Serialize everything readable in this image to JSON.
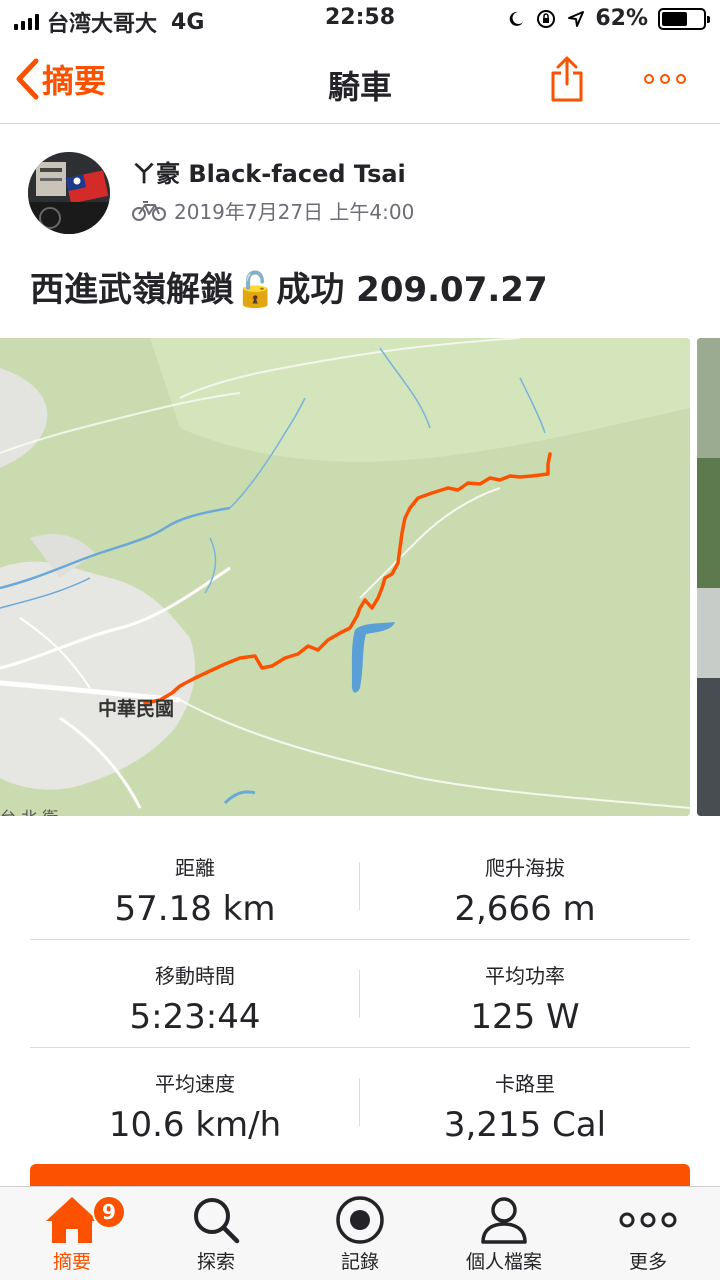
{
  "status_bar": {
    "carrier": "台湾大哥大",
    "network": "4G",
    "time": "22:58",
    "battery": "62%",
    "battery_level": 0.62
  },
  "nav": {
    "back_label": "摘要",
    "title": "騎車",
    "accent": "#fc5200"
  },
  "athlete": {
    "name": "ㄚ豪 Black-faced Tsai",
    "date": "2019年7月27日 上午4:00"
  },
  "activity": {
    "title": "西進武嶺解鎖🔓成功 209.07.27"
  },
  "map": {
    "place_label": "中華民國",
    "edge_label": "台 北 衛"
  },
  "stats": [
    {
      "left": {
        "label": "距離",
        "value": "57.18 km"
      },
      "right": {
        "label": "爬升海拔",
        "value": "2,666 m"
      }
    },
    {
      "left": {
        "label": "移動時間",
        "value": "5:23:44"
      },
      "right": {
        "label": "平均功率",
        "value": "125 W"
      }
    },
    {
      "left": {
        "label": "平均速度",
        "value": "10.6 km/h"
      },
      "right": {
        "label": "卡路里",
        "value": "3,215 Cal"
      }
    }
  ],
  "tabs": {
    "feed": {
      "label": "摘要",
      "badge": "9",
      "icon": "home-icon"
    },
    "explore": {
      "label": "探索",
      "icon": "search-icon"
    },
    "record": {
      "label": "記錄",
      "icon": "record-icon"
    },
    "profile": {
      "label": "個人檔案",
      "icon": "profile-icon"
    },
    "more": {
      "label": "更多",
      "icon": "more-icon"
    }
  }
}
